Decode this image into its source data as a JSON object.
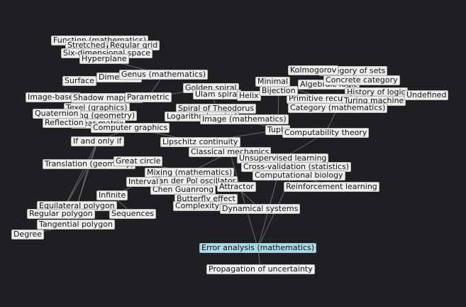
{
  "graph": {
    "background": "#1e1f23",
    "node_color": "#eeeeee",
    "highlight_color": "#add8e6",
    "edge_color": "#8a8a8a",
    "nodes": [
      {
        "id": "n1",
        "label": "Function (mathematics)"
      },
      {
        "id": "n2",
        "label": "Stretched"
      },
      {
        "id": "n3",
        "label": "Regular grid"
      },
      {
        "id": "n4",
        "label": "Six-dimensional space"
      },
      {
        "id": "n5",
        "label": "Hyperplane"
      },
      {
        "id": "n6",
        "label": "Surface"
      },
      {
        "id": "n7",
        "label": "Dimension"
      },
      {
        "id": "n8",
        "label": "Genus (mathematics)"
      },
      {
        "id": "n9",
        "label": "Image-based"
      },
      {
        "id": "n10",
        "label": "Shadow mapping"
      },
      {
        "id": "n11",
        "label": "Parametric"
      },
      {
        "id": "n12",
        "label": "Golden spiral"
      },
      {
        "id": "n13",
        "label": "Ulam spiral"
      },
      {
        "id": "n14",
        "label": "Helix"
      },
      {
        "id": "n15",
        "label": "Texel (graphics)"
      },
      {
        "id": "n16",
        "label": "Scaling (geometry)"
      },
      {
        "id": "n17",
        "label": "Shear matrix"
      },
      {
        "id": "n18",
        "label": "Spiral of Theodorus"
      },
      {
        "id": "n19",
        "label": "Logarithmic spiral"
      },
      {
        "id": "n20",
        "label": "Computer graphics"
      },
      {
        "id": "n21",
        "label": "If and only if"
      },
      {
        "id": "n22",
        "label": "Lipschitz continuity"
      },
      {
        "id": "n23",
        "label": "Classical mechanics"
      },
      {
        "id": "n24",
        "label": "Translation (geometry)"
      },
      {
        "id": "n25",
        "label": "Great circle"
      },
      {
        "id": "n26",
        "label": "Mixing (mathematics)"
      },
      {
        "id": "n27",
        "label": "Van der Pol oscillator"
      },
      {
        "id": "n28",
        "label": "Chen Guanrong"
      },
      {
        "id": "n29",
        "label": "Butterfly effect"
      },
      {
        "id": "n30",
        "label": "Complexity"
      },
      {
        "id": "n31",
        "label": "Equilateral polygon"
      },
      {
        "id": "n32",
        "label": "Regular polygon"
      },
      {
        "id": "n33",
        "label": "Tangential polygon"
      },
      {
        "id": "n34",
        "label": "Sequences"
      },
      {
        "id": "n35",
        "label": "Category of sets"
      },
      {
        "id": "n36",
        "label": "Algebraic logic"
      },
      {
        "id": "n37",
        "label": "History of logic"
      },
      {
        "id": "n38",
        "label": "Primitive recursive"
      },
      {
        "id": "n39",
        "label": "Turing machine"
      },
      {
        "id": "n40",
        "label": "Category (mathematics)"
      },
      {
        "id": "n41",
        "label": "Bijection"
      },
      {
        "id": "n42",
        "label": "Tuple"
      },
      {
        "id": "n43",
        "label": "Computability theory"
      },
      {
        "id": "n44",
        "label": "Unsupervised learning"
      },
      {
        "id": "n45",
        "label": "Cross-validation (statistics)"
      },
      {
        "id": "n46",
        "label": "Computational biology"
      },
      {
        "id": "n47",
        "label": "Error analysis (mathematics)",
        "highlight": true
      },
      {
        "id": "n48",
        "label": "Propagation of uncertainty"
      },
      {
        "id": "n49",
        "label": "Kolmogorov"
      },
      {
        "id": "n50",
        "label": "Concrete category"
      },
      {
        "id": "n51",
        "label": "Minimal"
      },
      {
        "id": "n52",
        "label": "Undefined"
      },
      {
        "id": "n53",
        "label": "Infinite"
      },
      {
        "id": "n54",
        "label": "Dynamical systems"
      },
      {
        "id": "n55",
        "label": "Interval"
      },
      {
        "id": "n56",
        "label": "Attractor"
      },
      {
        "id": "n57",
        "label": "Reinforcement learning"
      },
      {
        "id": "n58",
        "label": "Image (mathematics)"
      },
      {
        "id": "n59",
        "label": "Degree"
      },
      {
        "id": "n60",
        "label": "Reflection"
      },
      {
        "id": "n61",
        "label": "Quaternion"
      }
    ],
    "edges": [
      [
        "n1",
        "n4"
      ],
      [
        "n2",
        "n3"
      ],
      [
        "n4",
        "n5"
      ],
      [
        "n5",
        "n8"
      ],
      [
        "n6",
        "n7"
      ],
      [
        "n7",
        "n8"
      ],
      [
        "n8",
        "n11"
      ],
      [
        "n9",
        "n10"
      ],
      [
        "n10",
        "n11"
      ],
      [
        "n11",
        "n12"
      ],
      [
        "n12",
        "n13"
      ],
      [
        "n13",
        "n14"
      ],
      [
        "n15",
        "n16"
      ],
      [
        "n16",
        "n17"
      ],
      [
        "n17",
        "n20"
      ],
      [
        "n18",
        "n19"
      ],
      [
        "n12",
        "n18"
      ],
      [
        "n19",
        "n58"
      ],
      [
        "n20",
        "n21"
      ],
      [
        "n21",
        "n24"
      ],
      [
        "n21",
        "n31"
      ],
      [
        "n21",
        "n32"
      ],
      [
        "n24",
        "n32"
      ],
      [
        "n24",
        "n31"
      ],
      [
        "n20",
        "n22"
      ],
      [
        "n22",
        "n23"
      ],
      [
        "n23",
        "n26"
      ],
      [
        "n25",
        "n26"
      ],
      [
        "n26",
        "n27"
      ],
      [
        "n27",
        "n28"
      ],
      [
        "n28",
        "n29"
      ],
      [
        "n29",
        "n30"
      ],
      [
        "n30",
        "n54"
      ],
      [
        "n31",
        "n33"
      ],
      [
        "n32",
        "n33"
      ],
      [
        "n33",
        "n59"
      ],
      [
        "n34",
        "n53"
      ],
      [
        "n53",
        "n55"
      ],
      [
        "n55",
        "n56"
      ],
      [
        "n56",
        "n54"
      ],
      [
        "n44",
        "n45"
      ],
      [
        "n45",
        "n46"
      ],
      [
        "n46",
        "n57"
      ],
      [
        "n44",
        "n47"
      ],
      [
        "n45",
        "n47"
      ],
      [
        "n47",
        "n48"
      ],
      [
        "n35",
        "n36"
      ],
      [
        "n36",
        "n37"
      ],
      [
        "n37",
        "n39"
      ],
      [
        "n38",
        "n39"
      ],
      [
        "n39",
        "n40"
      ],
      [
        "n40",
        "n43"
      ],
      [
        "n41",
        "n42"
      ],
      [
        "n42",
        "n43"
      ],
      [
        "n43",
        "n44"
      ],
      [
        "n49",
        "n35"
      ],
      [
        "n50",
        "n40"
      ],
      [
        "n51",
        "n38"
      ],
      [
        "n52",
        "n37"
      ],
      [
        "n23",
        "n44"
      ],
      [
        "n22",
        "n42"
      ],
      [
        "n14",
        "n41"
      ],
      [
        "n60",
        "n61"
      ],
      [
        "n61",
        "n16"
      ],
      [
        "n9",
        "n15"
      ],
      [
        "n58",
        "n42"
      ],
      [
        "n23",
        "n47"
      ]
    ]
  }
}
